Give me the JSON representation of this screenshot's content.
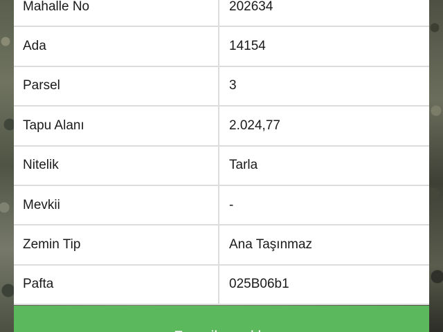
{
  "parcel_info": {
    "rows": [
      {
        "label": "Mahalle No",
        "value": "202634"
      },
      {
        "label": "Ada",
        "value": "14154"
      },
      {
        "label": "Parsel",
        "value": "3"
      },
      {
        "label": "Tapu Alanı",
        "value": "2.024,77"
      },
      {
        "label": "Nitelik",
        "value": "Tarla"
      },
      {
        "label": "Mevkii",
        "value": "-"
      },
      {
        "label": "Zemin Tip",
        "value": "Ana Taşınmaz"
      },
      {
        "label": "Pafta",
        "value": "025B06b1"
      }
    ]
  },
  "actions": {
    "add_favorite_label": "Favorilere ekle"
  },
  "colors": {
    "button_green": "#5cb85c",
    "table_border": "#dcdcdc"
  }
}
